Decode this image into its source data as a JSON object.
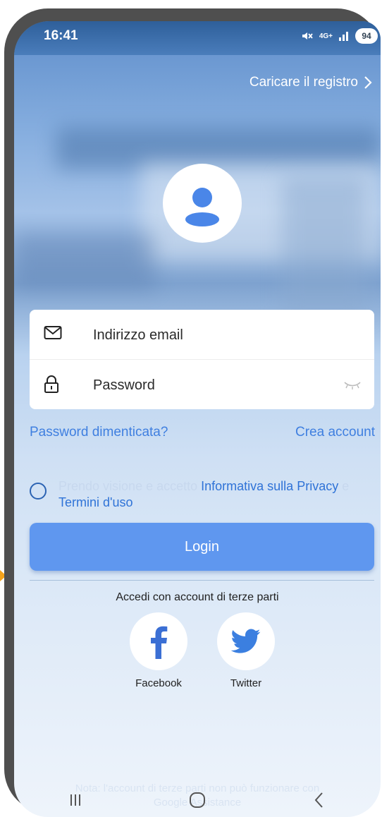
{
  "status_bar": {
    "time": "16:41",
    "network": "4G+",
    "battery": "94"
  },
  "header": {
    "upload_log_label": "Caricare il registro"
  },
  "login_form": {
    "email_placeholder": "Indirizzo email",
    "password_placeholder": "Password"
  },
  "links": {
    "forgot_password": "Password dimenticata?",
    "create_account": "Crea account"
  },
  "consent": {
    "prefix": "Prendo visione e accetto",
    "privacy_label": "Informativa sulla Privacy",
    "conjunction": "e",
    "terms_label": "Termini d'uso"
  },
  "login_button_label": "Login",
  "third_party": {
    "title": "Accedi con account di terze parti",
    "providers": [
      {
        "name": "Facebook",
        "color": "#3b6fd4"
      },
      {
        "name": "Twitter",
        "color": "#3b7fe0"
      }
    ]
  },
  "note": {
    "line1": "Nota: l'account di terze parti non può funzionare con",
    "line2": "Google Assistance"
  },
  "colors": {
    "accent": "#5f97ef",
    "link": "#3f7fe0",
    "phone_frame": "#4f4f4f",
    "marker": "#f3a21b"
  }
}
